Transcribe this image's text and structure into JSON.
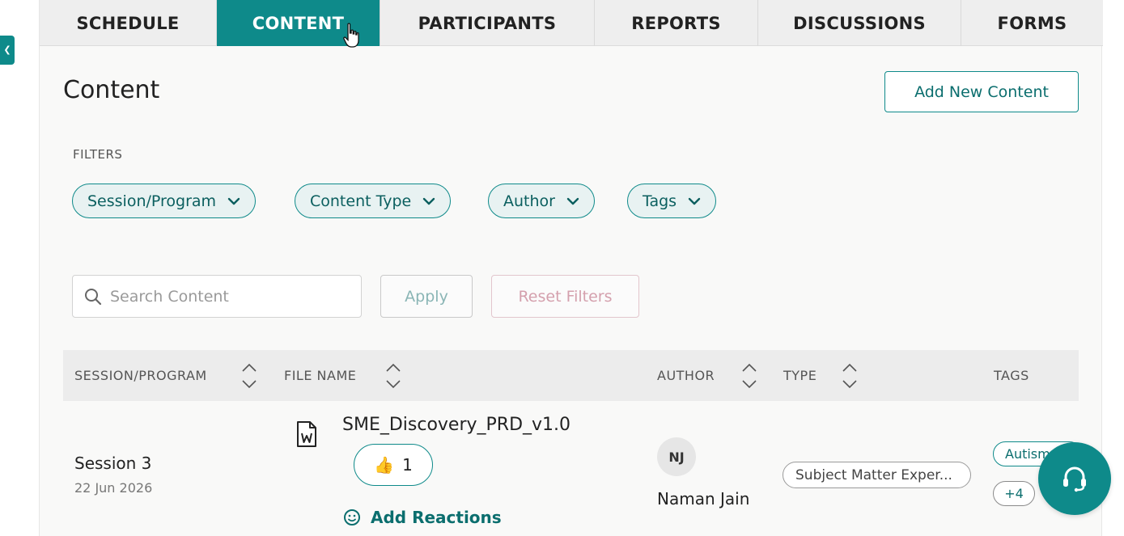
{
  "side_tab_icon": "chevron-left-icon",
  "tabs": [
    {
      "label": "SCHEDULE",
      "active": false
    },
    {
      "label": "CONTENT",
      "active": true
    },
    {
      "label": "PARTICIPANTS",
      "active": false
    },
    {
      "label": "REPORTS",
      "active": false
    },
    {
      "label": "DISCUSSIONS",
      "active": false
    },
    {
      "label": "FORMS",
      "active": false
    }
  ],
  "header": {
    "title": "Content",
    "add_button": "Add New Content"
  },
  "filters": {
    "label": "FILTERS",
    "dropdowns": [
      "Session/Program",
      "Content Type",
      "Author",
      "Tags"
    ],
    "search_placeholder": "Search Content",
    "apply": "Apply",
    "reset": "Reset Filters"
  },
  "table": {
    "columns": [
      "SESSION/PROGRAM",
      "FILE NAME",
      "AUTHOR",
      "TYPE",
      "TAGS"
    ],
    "rows": [
      {
        "session": "Session 3",
        "date": "22 Jun 2026",
        "file_icon": "word-document-icon",
        "file_name": "SME_Discovery_PRD_v1.0",
        "reaction_emoji": "👍",
        "reaction_count": "1",
        "add_reactions": "Add Reactions",
        "author_initials": "NJ",
        "author_name": "Naman Jain",
        "type": "Subject Matter Exper...",
        "tag": "Autism",
        "more_tags": "+4"
      }
    ]
  },
  "support_icon": "headset-icon",
  "colors": {
    "accent": "#0e8a8a",
    "accent_dark": "#0b6e6e",
    "pill_bg": "#e8f2f2",
    "reset_text": "#d4a0ad"
  }
}
